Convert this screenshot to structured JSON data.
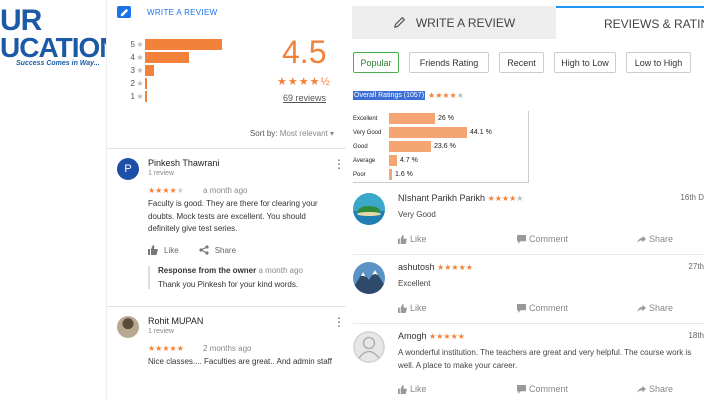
{
  "logo": {
    "line1": "UR",
    "line2": "UCATION",
    "tagline": "Success Comes in Way..."
  },
  "google_panel": {
    "write_review_label": "WRITE A REVIEW",
    "distribution": [
      {
        "star": "5",
        "fraction": 0.77
      },
      {
        "star": "4",
        "fraction": 0.44
      },
      {
        "star": "3",
        "fraction": 0.09
      },
      {
        "star": "2",
        "fraction": 0.02
      },
      {
        "star": "1",
        "fraction": 0.01
      }
    ],
    "average_rating": "4.5",
    "stars_display": "★★★★½",
    "review_count_label": "69 reviews",
    "sort_label": "Sort by:",
    "sort_value": "Most relevant ▾",
    "reviews": [
      {
        "avatar_letter": "P",
        "name": "Pinkesh Thawrani",
        "sub": "1 review",
        "stars_filled": "★★★★",
        "stars_empty": "★",
        "time": "a month ago",
        "text": "Faculty is good. They are there for clearing your doubts. Mock tests are excellent. You should definitely give test series.",
        "like_label": "Like",
        "share_label": "Share",
        "owner_response_label": "Response from the owner",
        "owner_response_time": "a month ago",
        "owner_response_text": "Thank you Pinkesh for your kind words."
      },
      {
        "name": "Rohit MUPAN",
        "sub": "1 review",
        "stars_filled": "★★★★★",
        "time": "2 months ago",
        "text": "Nice classes.... Faculties are great.. And admin staff"
      }
    ]
  },
  "site_panel": {
    "tab_write": "WRITE A REVIEW",
    "tab_reviews": "REVIEWS & RATINGS",
    "filters": [
      "Popular",
      "Friends Rating",
      "Recent",
      "High to Low",
      "Low to High"
    ],
    "active_filter": "Popular",
    "overall_label": "Overall Ratings (1057)",
    "overall_stars_filled": "★★★★",
    "overall_stars_empty": "★",
    "histogram": [
      {
        "label": "Excellent",
        "value": 26,
        "display": "26 %"
      },
      {
        "label": "Very Good",
        "value": 44.1,
        "display": "44.1 %"
      },
      {
        "label": "Good",
        "value": 23.6,
        "display": "23.6 %"
      },
      {
        "label": "Average",
        "value": 4.7,
        "display": "4.7 %"
      },
      {
        "label": "Poor",
        "value": 1.6,
        "display": "1.6 %"
      }
    ],
    "reviews": [
      {
        "name": "NIshant Parikh Parikh",
        "stars_filled": "★★★★",
        "stars_empty": "★",
        "date": "16th D",
        "text": "Very Good",
        "avatar": "island"
      },
      {
        "name": "ashutosh",
        "stars_filled": "★★★★★",
        "stars_empty": "",
        "date": "27th",
        "text": "Excellent",
        "avatar": "mountain"
      },
      {
        "name": "Amogh",
        "stars_filled": "★★★★★",
        "stars_empty": "",
        "date": "18th",
        "text": "A wonderful institution. The teachers are great and very helpful. The course work is well. A place to make your career.",
        "avatar": "default-user"
      }
    ],
    "like_label": "Like",
    "comment_label": "Comment",
    "share_label": "Share"
  },
  "colors": {
    "accent_orange": "#f2813a",
    "google_blue": "#1a73e8",
    "logo_blue": "#1c5aa6",
    "filter_active_green": "#4caf50",
    "tab_active_blue": "#2196f3"
  }
}
